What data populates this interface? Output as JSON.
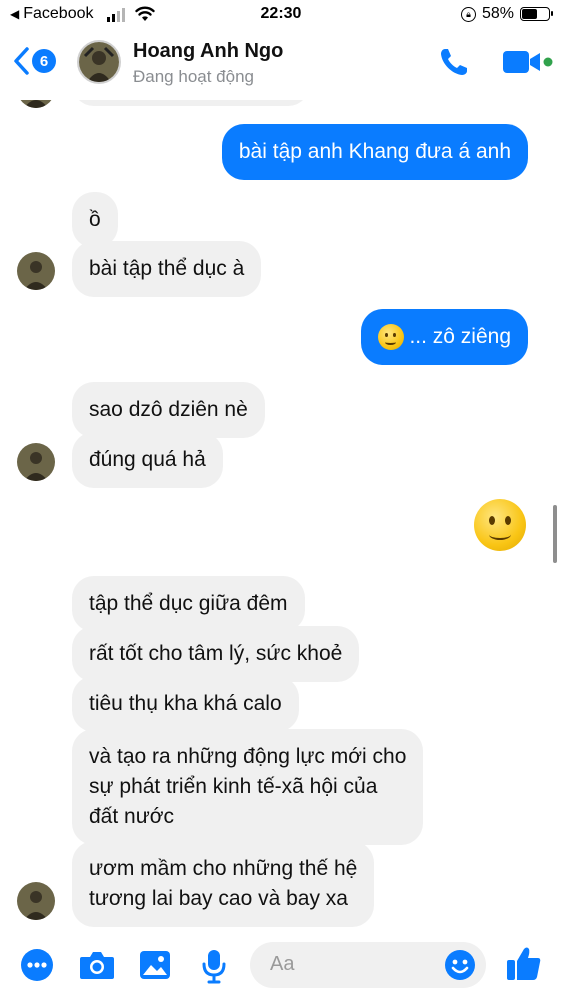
{
  "status_bar": {
    "back_app": "Facebook",
    "time": "22:30",
    "battery_percent": "58%",
    "battery_level": 0.58
  },
  "header": {
    "unread_count": "6",
    "name": "Hoang Anh Ngo",
    "status": "Đang hoạt động",
    "icons": [
      "back-chevron-icon",
      "phone-icon",
      "video-camera-icon"
    ],
    "accent_color": "#0a7cff",
    "online_color": "#31a24c"
  },
  "messages": [
    {
      "side": "out",
      "text": "bài tập anh Khang đưa á anh"
    },
    {
      "side": "in",
      "text": "ồ"
    },
    {
      "side": "in",
      "text": "bài tập thể dục à"
    },
    {
      "side": "out",
      "text": "... zô ziêng",
      "emoji": "slightly-smiling-face"
    },
    {
      "side": "in",
      "text": "sao dzô dziên nè"
    },
    {
      "side": "in",
      "text": "đúng quá hả"
    },
    {
      "side": "out",
      "emoji": "slightly-smiling-face"
    },
    {
      "side": "in",
      "text": "tập thể dục giữa đêm"
    },
    {
      "side": "in",
      "text": "rất tốt cho tâm lý, sức khoẻ"
    },
    {
      "side": "in",
      "text": "tiêu thụ kha khá calo"
    },
    {
      "side": "in",
      "lines": [
        "và tạo ra những động lực mới cho",
        "sự phát triển kinh tế-xã hội của",
        "đất nước"
      ]
    },
    {
      "side": "in",
      "lines": [
        "ươm mầm cho những thế hệ",
        "tương lai bay cao và bay xa"
      ]
    }
  ],
  "composer": {
    "placeholder": "Aa",
    "icons": [
      "more-icon",
      "camera-icon",
      "image-icon",
      "microphone-icon",
      "emoji-icon",
      "thumbs-up-icon"
    ]
  }
}
